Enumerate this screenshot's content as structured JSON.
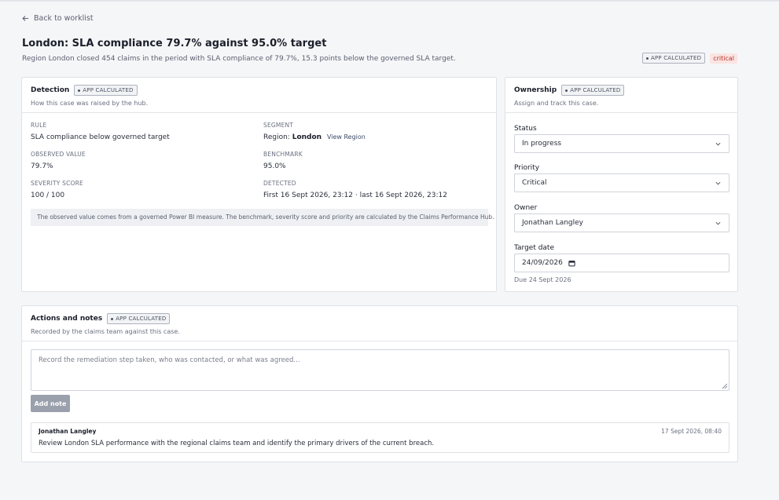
{
  "nav": {
    "back_label": "Back to worklist"
  },
  "header": {
    "title": "London: SLA compliance 79.7% against 95.0% target",
    "subtitle": "Region London closed 454 claims in the period with SLA compliance of 79.7%, 15.3 points below the governed SLA target.",
    "tag": "APP CALCULATED",
    "severity": "critical"
  },
  "detection": {
    "title": "Detection",
    "tag": "APP CALCULATED",
    "desc": "How this case was raised by the hub.",
    "rule_label": "RULE",
    "rule_value": "SLA compliance below governed target",
    "segment_label": "SEGMENT",
    "segment_prefix": "Region:",
    "segment_value": "London",
    "segment_link": "View Region",
    "observed_label": "OBSERVED VALUE",
    "observed_value": "79.7%",
    "benchmark_label": "BENCHMARK",
    "benchmark_value": "95.0%",
    "severity_label": "SEVERITY SCORE",
    "severity_value": "100 / 100",
    "detected_label": "DETECTED",
    "detected_value": "First 16 Sept 2026, 23:12 · last 16 Sept 2026, 23:12",
    "note": "The observed value comes from a governed Power BI measure. The benchmark, severity score and priority are calculated by the Claims Performance Hub."
  },
  "ownership": {
    "title": "Ownership",
    "tag": "APP CALCULATED",
    "desc": "Assign and track this case.",
    "status_label": "Status",
    "status_value": "In progress",
    "priority_label": "Priority",
    "priority_value": "Critical",
    "owner_label": "Owner",
    "owner_value": "Jonathan Langley",
    "target_label": "Target date",
    "target_value": "24/09/2026",
    "due_text": "Due 24 Sept 2026"
  },
  "actions": {
    "title": "Actions and notes",
    "tag": "APP CALCULATED",
    "desc": "Recorded by the claims team against this case.",
    "placeholder": "Record the remediation step taken, who was contacted, or what was agreed...",
    "add_label": "Add note",
    "entries": [
      {
        "author": "Jonathan Langley",
        "time": "17 Sept 2026, 08:40",
        "text": "Review London SLA performance with the regional claims team and identify the primary drivers of the current breach."
      }
    ]
  }
}
